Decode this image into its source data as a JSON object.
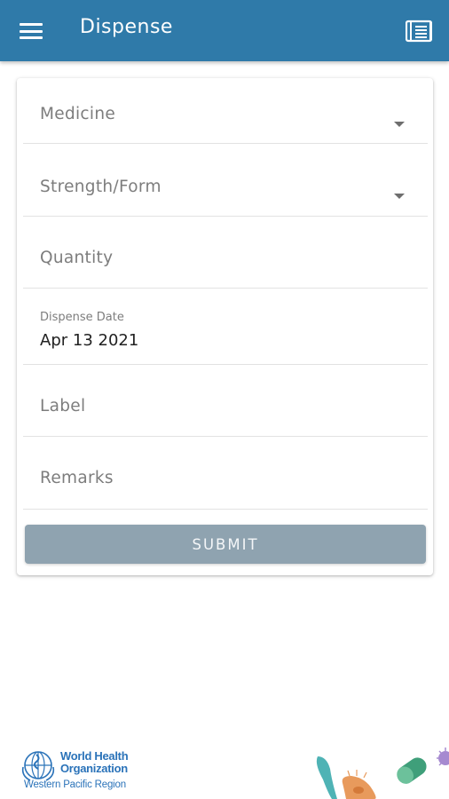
{
  "header": {
    "title": "Dispense",
    "menu_icon": "hamburger-menu-icon",
    "book_icon": "book-icon"
  },
  "form": {
    "medicine_placeholder": "Medicine",
    "strength_placeholder": "Strength/Form",
    "quantity_placeholder": "Quantity",
    "dispense_date_label": "Dispense Date",
    "dispense_date_value": "Apr 13 2021",
    "label_placeholder": "Label",
    "remarks_placeholder": "Remarks",
    "submit_label": "SUBMIT"
  },
  "footer": {
    "org_line1": "World Health",
    "org_line2": "Organization",
    "org_region": "Western Pacific Region"
  },
  "colors": {
    "app_bar": "#2f7aa9",
    "submit_button": "#8fa3b0",
    "who_blue": "#2b73b9"
  }
}
